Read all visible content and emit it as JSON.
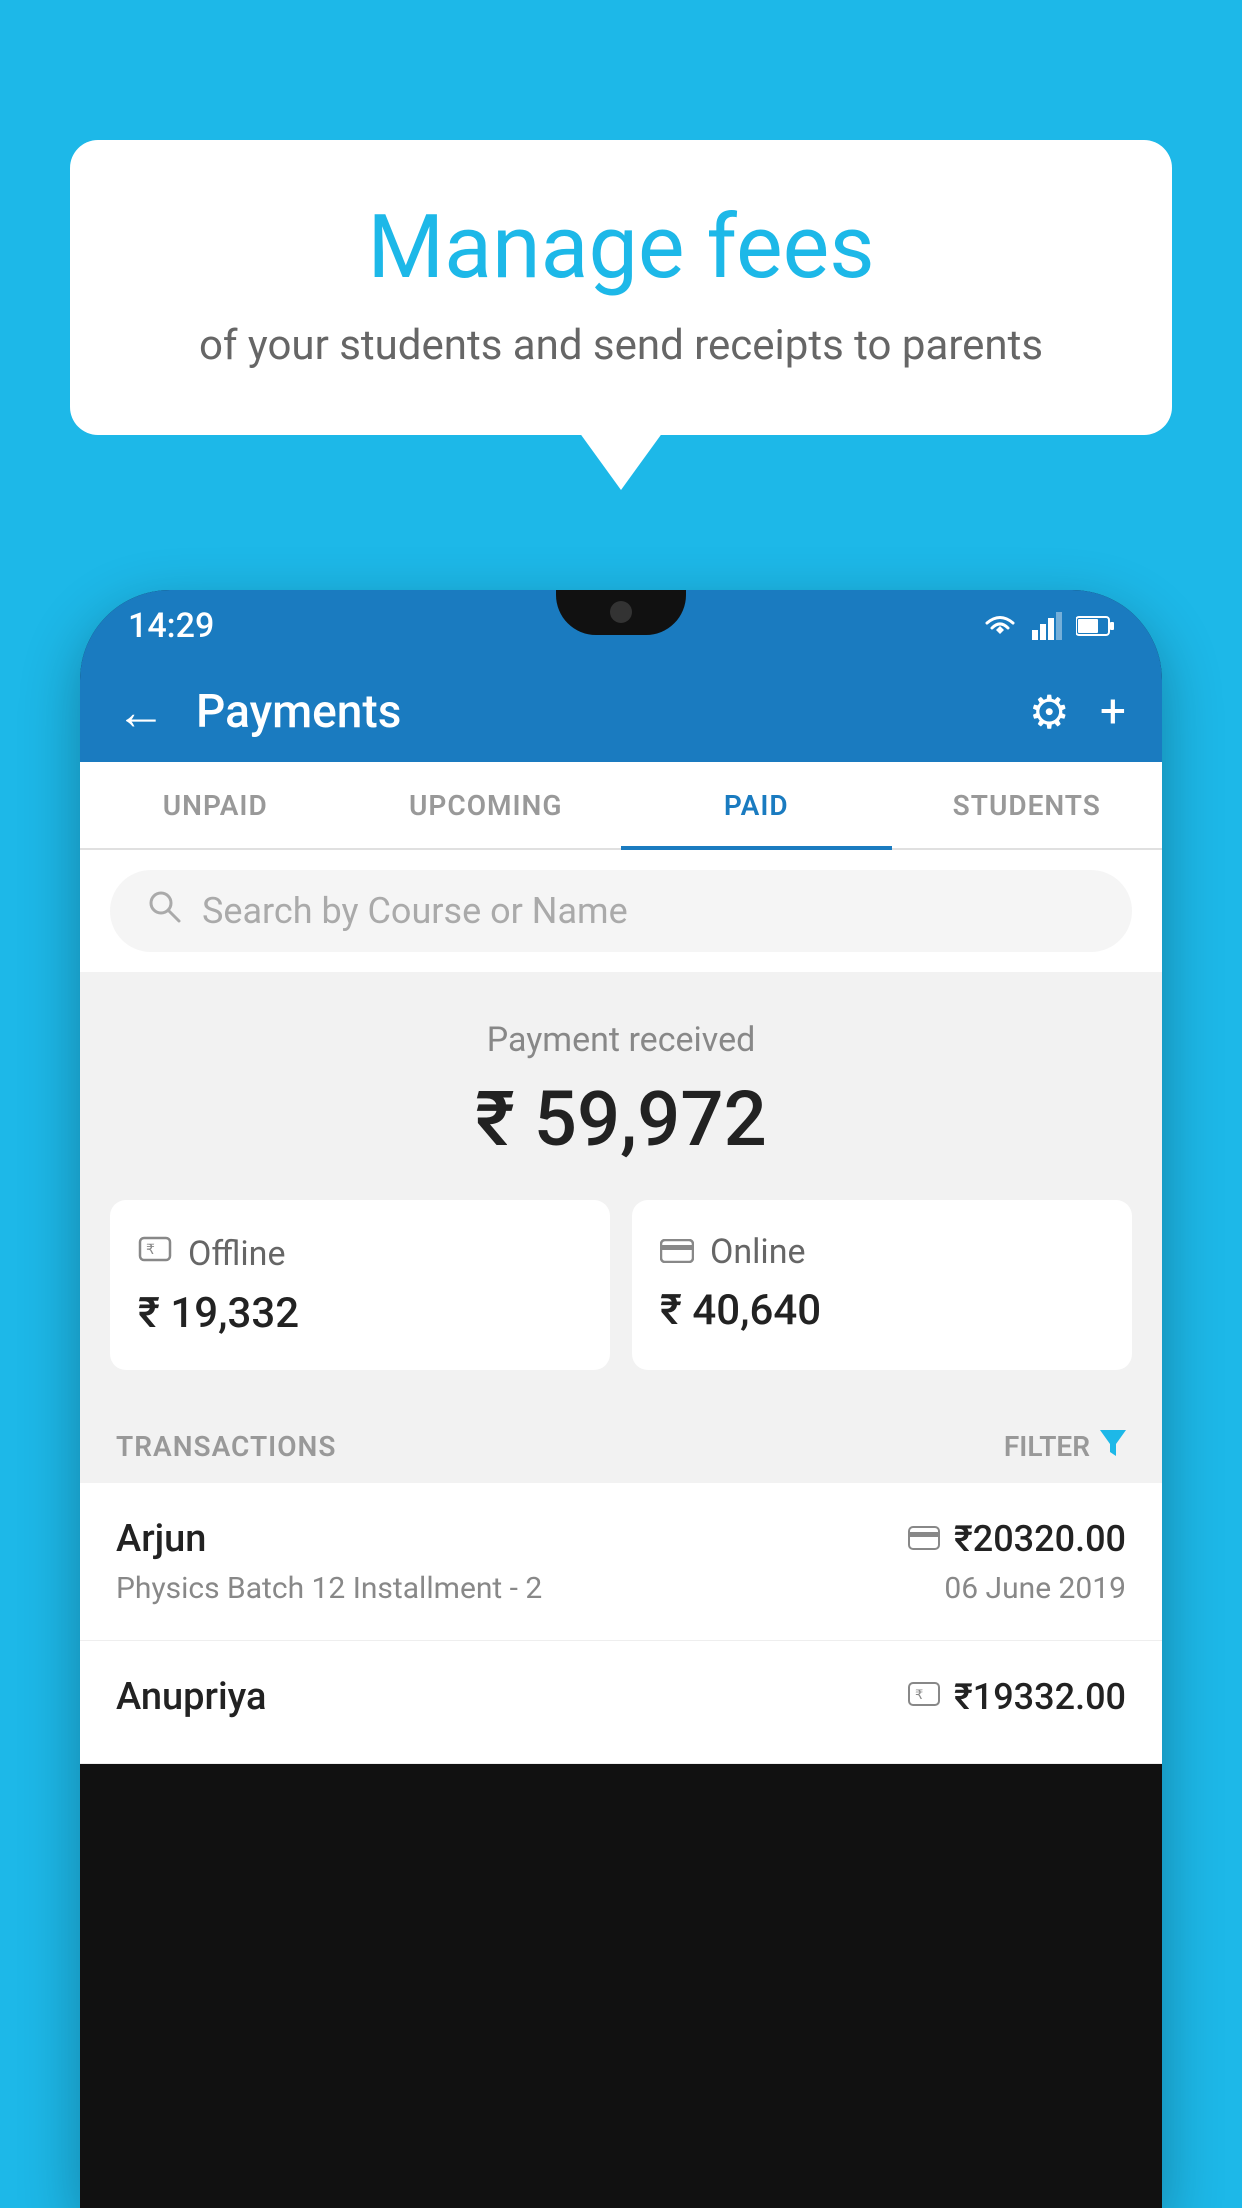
{
  "background_color": "#1db8e8",
  "speech_bubble": {
    "title": "Manage fees",
    "subtitle": "of your students and send receipts to parents"
  },
  "status_bar": {
    "time": "14:29"
  },
  "app_bar": {
    "title": "Payments",
    "back_label": "←",
    "settings_label": "⚙",
    "add_label": "+"
  },
  "tabs": [
    {
      "label": "UNPAID",
      "active": false
    },
    {
      "label": "UPCOMING",
      "active": false
    },
    {
      "label": "PAID",
      "active": true
    },
    {
      "label": "STUDENTS",
      "active": false
    }
  ],
  "search": {
    "placeholder": "Search by Course or Name"
  },
  "payment_received": {
    "label": "Payment received",
    "amount": "₹ 59,972"
  },
  "payment_cards": [
    {
      "icon": "💳",
      "label": "Offline",
      "amount": "₹ 19,332"
    },
    {
      "icon": "💳",
      "label": "Online",
      "amount": "₹ 40,640"
    }
  ],
  "transactions_section": {
    "label": "TRANSACTIONS",
    "filter_label": "FILTER"
  },
  "transactions": [
    {
      "name": "Arjun",
      "course": "Physics Batch 12 Installment - 2",
      "amount": "₹20320.00",
      "date": "06 June 2019",
      "payment_type": "online"
    },
    {
      "name": "Anupriya",
      "course": "",
      "amount": "₹19332.00",
      "date": "",
      "payment_type": "offline"
    }
  ]
}
